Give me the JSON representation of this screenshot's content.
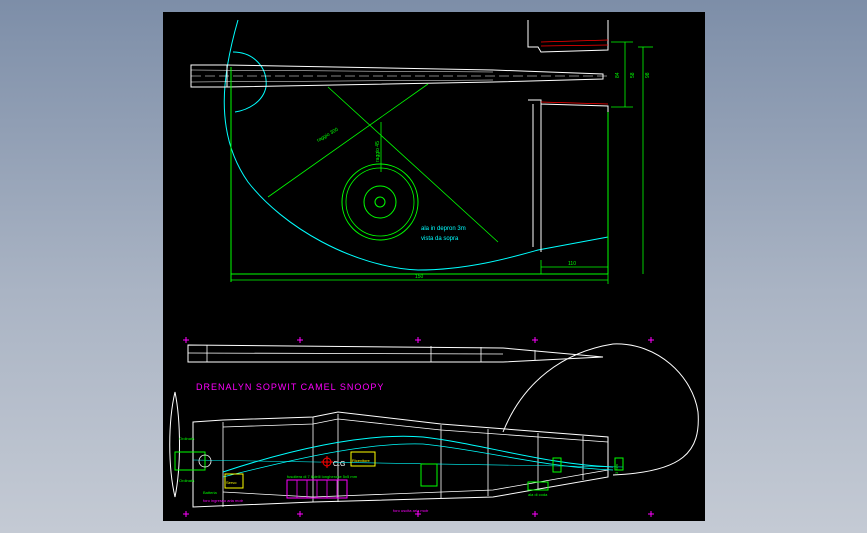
{
  "title": "DRENALYN SOPWIT CAMEL SNOOPY",
  "top_view": {
    "label_line1": "ala in depron 3m",
    "label_line2": "vista da sopra",
    "radius_label": "raggio 300",
    "small_label": "raggio 45",
    "dim_bottom": "150",
    "dim_bottom_right": "110",
    "dim_right_1": "84",
    "dim_right_2": "58",
    "dim_right_3": "98"
  },
  "side_view": {
    "cg_label": "C.G",
    "note_center": "fusoliera di 7 listelli longherone 5x5 mm",
    "note_left_bottom": "foro ingresso aria motr",
    "note_bottom": "foro uscita aria motr",
    "box_left": "Servo",
    "box_center": "Ricevitore",
    "box_lower_left": "Batteria",
    "label_front_top": "Ordinata",
    "label_front_bottom": "Ordinata",
    "label_tail": "ala di coda",
    "label_tail_right": "3 mm"
  },
  "colors": {
    "background": "#000000",
    "outline": "#ffffff",
    "cyan": "#00ffff",
    "green": "#00ff00",
    "yellow": "#ffff00",
    "magenta": "#ff00ff",
    "red": "#ff0000"
  }
}
